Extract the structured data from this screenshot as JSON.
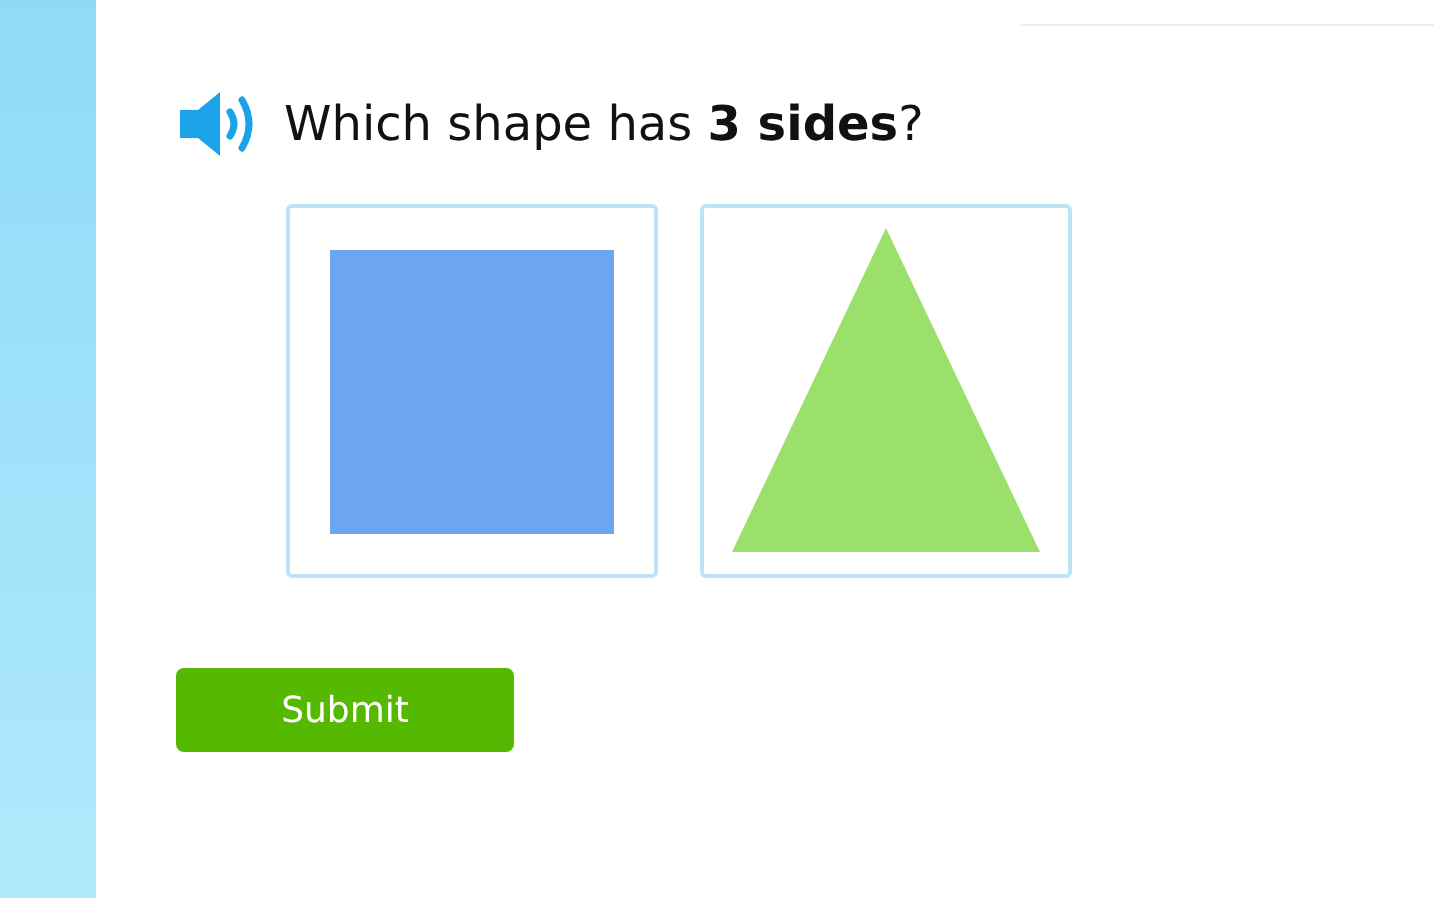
{
  "question": "Which shape has **3 sides**?",
  "choices": [
    {
      "kind": "square"
    },
    {
      "kind": "triangle"
    }
  ],
  "submit": "Submit"
}
